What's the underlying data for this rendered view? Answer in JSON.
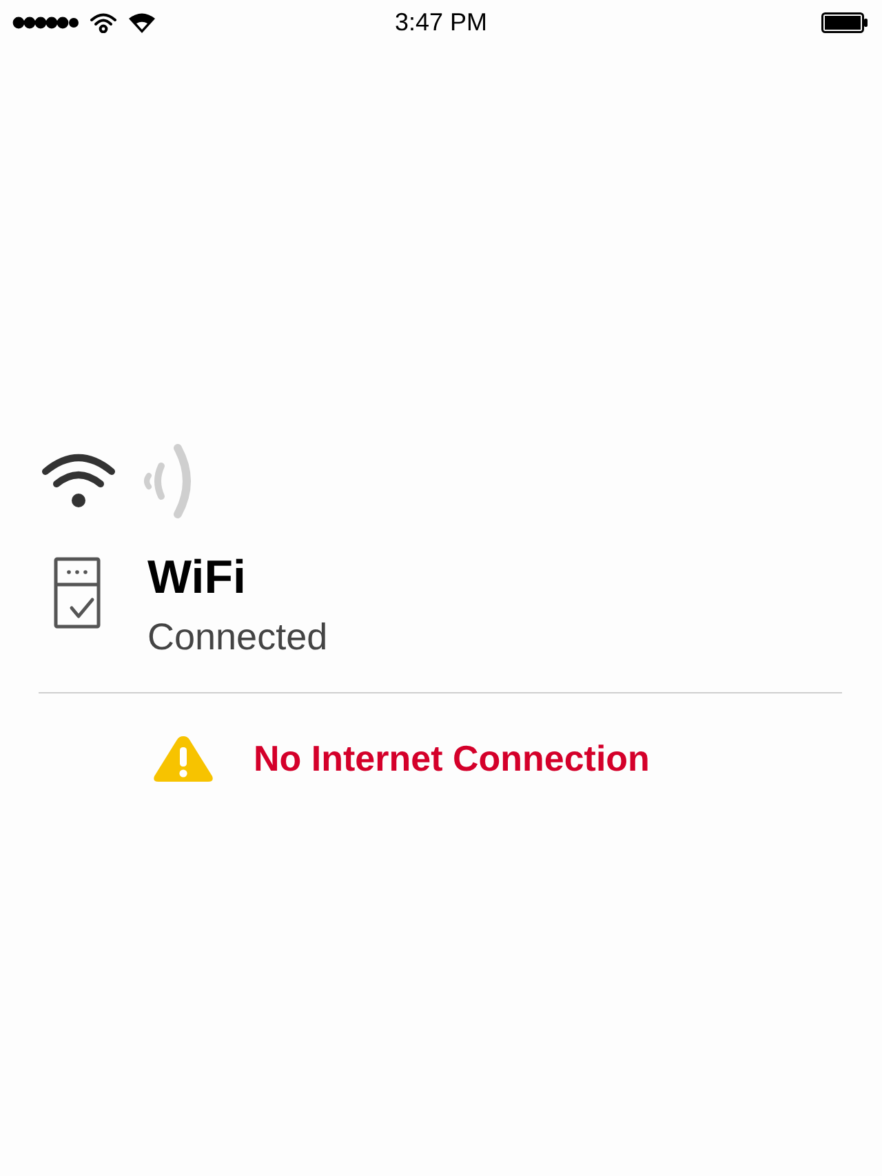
{
  "status_bar": {
    "time": "3:47 PM"
  },
  "network": {
    "name": "WiFi",
    "status": "Connected"
  },
  "alert": {
    "message": "No Internet Connection"
  }
}
